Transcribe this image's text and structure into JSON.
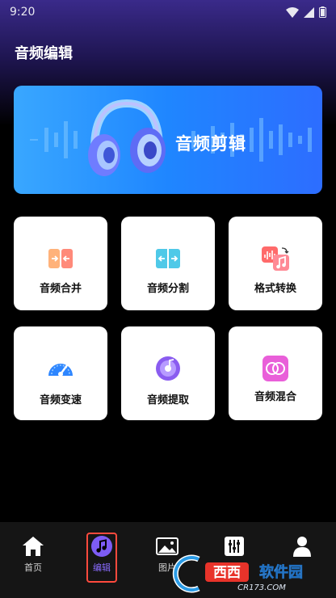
{
  "status": {
    "time": "9:20"
  },
  "header": {
    "title": "音频编辑"
  },
  "banner": {
    "title": "音频剪辑"
  },
  "tools": [
    {
      "label": "音频合并",
      "icon": "merge-icon"
    },
    {
      "label": "音频分割",
      "icon": "split-icon"
    },
    {
      "label": "格式转换",
      "icon": "format-convert-icon"
    },
    {
      "label": "音频变速",
      "icon": "speedometer-icon"
    },
    {
      "label": "音频提取",
      "icon": "music-disc-icon"
    },
    {
      "label": "音频混合",
      "icon": "mix-icon"
    }
  ],
  "nav": {
    "items": [
      {
        "label": "首页",
        "icon": "home-icon"
      },
      {
        "label": "编辑",
        "icon": "music-note-icon",
        "active": true
      },
      {
        "label": "图片",
        "icon": "image-icon"
      },
      {
        "label": "",
        "icon": "sliders-icon"
      },
      {
        "label": "",
        "icon": "user-icon"
      }
    ]
  },
  "watermark": {
    "text": "西西软件园",
    "sub": "CR173.COM"
  },
  "colors": {
    "accent": "#8a6cff",
    "banner": "#1f86ff",
    "highlight_border": "#ff4a3d"
  }
}
